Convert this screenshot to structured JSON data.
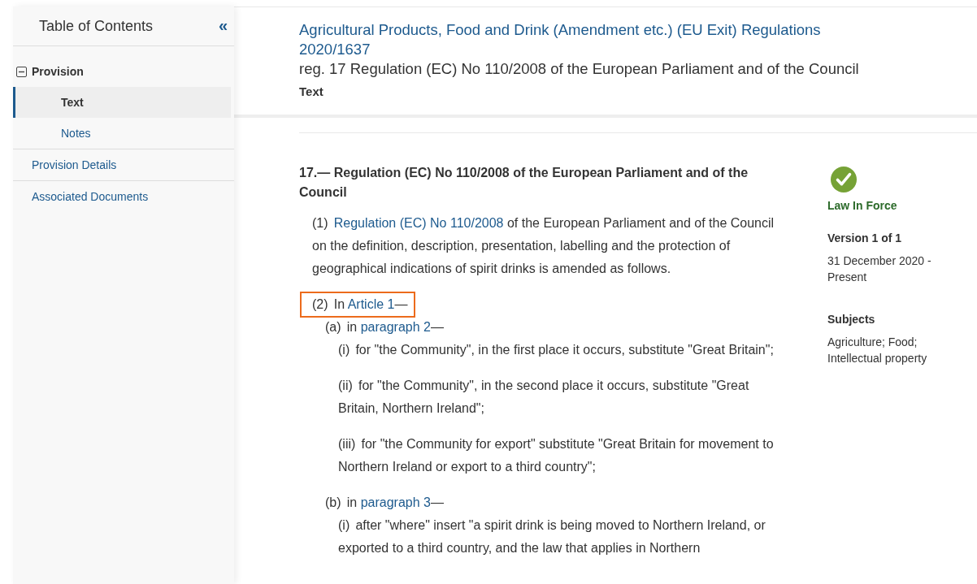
{
  "sidebar": {
    "title": "Table of Contents",
    "collapse": "«",
    "items": [
      {
        "label": "Provision",
        "selected": false,
        "expanded": true,
        "children": [
          {
            "label": "Text",
            "selected": true
          },
          {
            "label": "Notes",
            "selected": false
          }
        ]
      },
      {
        "label": "Provision Details",
        "selected": false
      },
      {
        "label": "Associated Documents",
        "selected": false
      }
    ]
  },
  "header": {
    "title": "Agricultural Products, Food and Drink (Amendment etc.) (EU Exit) Regulations 2020/1637",
    "subtitle": "reg. 17 Regulation (EC) No 110/2008 of the European Parliament and of the Council",
    "section": "Text"
  },
  "provision": {
    "heading": "17.— Regulation (EC) No 110/2008 of the European Parliament and of the Council",
    "paragraphs": [
      {
        "number": "(1)",
        "highlighted": false,
        "segments": [
          {
            "kind": "link",
            "text": "Regulation (EC) No 110/2008"
          },
          {
            "kind": "text",
            "text": " of the European Parliament and of the Council on the definition, description, presentation, labelling and the protection of geographical indications of spirit drinks is amended as follows."
          }
        ]
      },
      {
        "number": "(2)",
        "highlighted": true,
        "segments": [
          {
            "kind": "text",
            "text": "In "
          },
          {
            "kind": "link",
            "text": "Article 1"
          },
          {
            "kind": "text",
            "text": "—"
          }
        ],
        "children": [
          {
            "number": "(a)",
            "highlighted": false,
            "segments": [
              {
                "kind": "text",
                "text": "in "
              },
              {
                "kind": "link",
                "text": "paragraph 2"
              },
              {
                "kind": "text",
                "text": "—"
              }
            ],
            "children": [
              {
                "number": "(i)",
                "highlighted": false,
                "segments": [
                  {
                    "kind": "text",
                    "text": "for \"the Community\", in the first place it occurs, substitute \"Great Britain\";"
                  }
                ]
              },
              {
                "number": "(ii)",
                "highlighted": false,
                "segments": [
                  {
                    "kind": "text",
                    "text": "for \"the Community\", in the second place it occurs, substitute \"Great Britain, Northern Ireland\";"
                  }
                ]
              },
              {
                "number": "(iii)",
                "highlighted": false,
                "segments": [
                  {
                    "kind": "text",
                    "text": "for \"the Community for export\" substitute \"Great Britain for movement to Northern Ireland or export to a third country\";"
                  }
                ]
              }
            ]
          },
          {
            "number": "(b)",
            "highlighted": false,
            "segments": [
              {
                "kind": "text",
                "text": "in "
              },
              {
                "kind": "link",
                "text": "paragraph 3"
              },
              {
                "kind": "text",
                "text": "—"
              }
            ],
            "children": [
              {
                "number": "(i)",
                "highlighted": false,
                "segments": [
                  {
                    "kind": "text",
                    "text": "after \"where\" insert \"a spirit drink is being moved to Northern Ireland, or exported to a third country, and the law that applies in Northern"
                  }
                ]
              }
            ]
          }
        ]
      }
    ]
  },
  "info": {
    "status": {
      "kind": "in_force",
      "label": "Law In Force"
    },
    "version": "Version 1 of 1",
    "dates": "31 December 2020 - Present",
    "subjects_heading": "Subjects",
    "subjects": "Agriculture; Food; Intellectual property"
  }
}
